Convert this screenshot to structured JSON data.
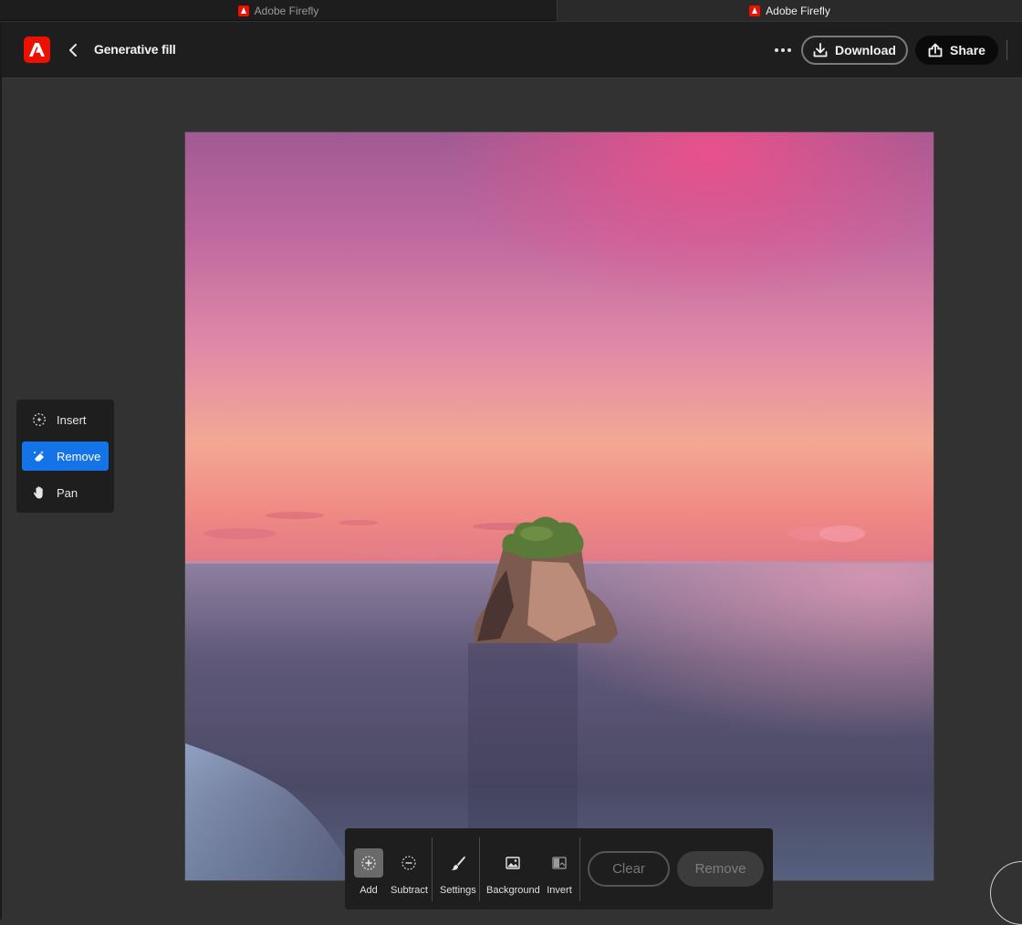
{
  "browser": {
    "tabs": [
      {
        "label": "Adobe Firefly"
      },
      {
        "label": "Adobe Firefly"
      }
    ]
  },
  "header": {
    "title": "Generative fill",
    "download_label": "Download",
    "share_label": "Share"
  },
  "left_tools": [
    {
      "label": "Insert",
      "icon": "sparkle-brush-icon",
      "active": false
    },
    {
      "label": "Remove",
      "icon": "eraser-icon",
      "active": true
    },
    {
      "label": "Pan",
      "icon": "hand-icon",
      "active": false
    }
  ],
  "bottom_tools": {
    "add": "Add",
    "subtract": "Subtract",
    "settings": "Settings",
    "background": "Background",
    "invert": "Invert",
    "clear": "Clear",
    "remove": "Remove"
  },
  "colors": {
    "accent": "#1473e6",
    "brand": "#eb1000"
  }
}
